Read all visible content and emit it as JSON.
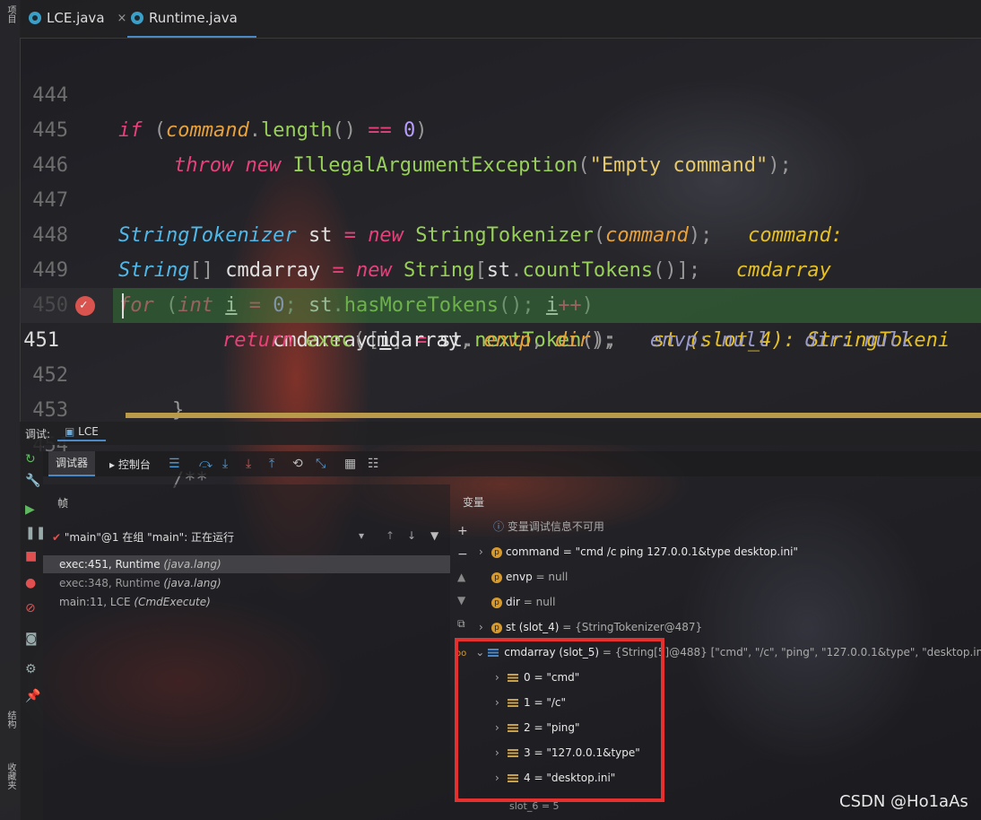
{
  "left_strip": {
    "project_label": "项目",
    "structure_label": "结构",
    "favorites_label": "收藏夹"
  },
  "tabs": [
    {
      "label": "LCE.java",
      "close": "×"
    },
    {
      "label": "Runtime.java",
      "close": ""
    }
  ],
  "code": {
    "lines": [
      {
        "num": "444"
      },
      {
        "num": "445"
      },
      {
        "num": "446"
      },
      {
        "num": "447"
      },
      {
        "num": "448"
      },
      {
        "num": "449"
      },
      {
        "num": "450"
      },
      {
        "num": "451"
      },
      {
        "num": "452"
      },
      {
        "num": "453"
      },
      {
        "num": "454"
      }
    ],
    "t": {
      "if": "if",
      "command": "command",
      "length": "length",
      "eq": "==",
      "zero": "0",
      "throw": "throw",
      "new": "new",
      "iae": "IllegalArgumentException",
      "empty": "\"Empty command\"",
      "stt": "StringTokenizer",
      "st": "st",
      "assign": "=",
      "stt2": "StringTokenizer",
      "command2": "command",
      "hint_command": "command:",
      "String": "String",
      "cmdarray": "cmdarray",
      "String2": "String",
      "countTokens": "countTokens",
      "hint_cmdarray": "cmdarray",
      "for": "for",
      "int": "int",
      "i": "i",
      "has": "hasMoreTokens",
      "inc": "++",
      "cmdarray2": "cmdarray",
      "nextToken": "nextToken",
      "hint_st": "st (slot_4): StringTokeni",
      "return": "return",
      "exec": "exec",
      "cmdarray3": "cmdarray",
      "envp": "envp",
      "dir": "dir",
      "hint_envp": "envp: null",
      "hint_dir": "dir: null",
      "close_brace": "}",
      "javadoc": "/**"
    }
  },
  "debug": {
    "header_label": "调试:",
    "session_tab": "LCE",
    "tabs": {
      "debugger": "调试器",
      "console": "控制台"
    },
    "frames_title": "帧",
    "thread": "\"main\"@1 在组 \"main\": 正在运行",
    "frames": [
      {
        "method": "exec:451, Runtime",
        "pkg": "(java.lang)"
      },
      {
        "method": "exec:348, Runtime",
        "pkg": "(java.lang)"
      },
      {
        "method": "main:11, LCE",
        "pkg": "(CmdExecute)"
      }
    ],
    "vars_title": "变量",
    "info": "变量调试信息不可用",
    "vars": [
      {
        "name": "command",
        "value": "= \"cmd /c ping 127.0.0.1&type desktop.ini\""
      },
      {
        "name": "envp",
        "value": "= null"
      },
      {
        "name": "dir",
        "value": "= null"
      },
      {
        "name": "st (slot_4)",
        "value": "= {StringTokenizer@487}"
      },
      {
        "name": "cmdarray (slot_5)",
        "value": "= {String[5]@488} [\"cmd\", \"/c\", \"ping\", \"127.0.0.1&type\", \"desktop.ini\"]"
      }
    ],
    "elements": [
      {
        "name": "0",
        "value": "= \"cmd\""
      },
      {
        "name": "1",
        "value": "= \"/c\""
      },
      {
        "name": "2",
        "value": "= \"ping\""
      },
      {
        "name": "3",
        "value": "= \"127.0.0.1&type\""
      },
      {
        "name": "4",
        "value": "= \"desktop.ini\""
      }
    ],
    "partial_var": "slot_6 = 5"
  },
  "watermark": "CSDN @Ho1aAs"
}
